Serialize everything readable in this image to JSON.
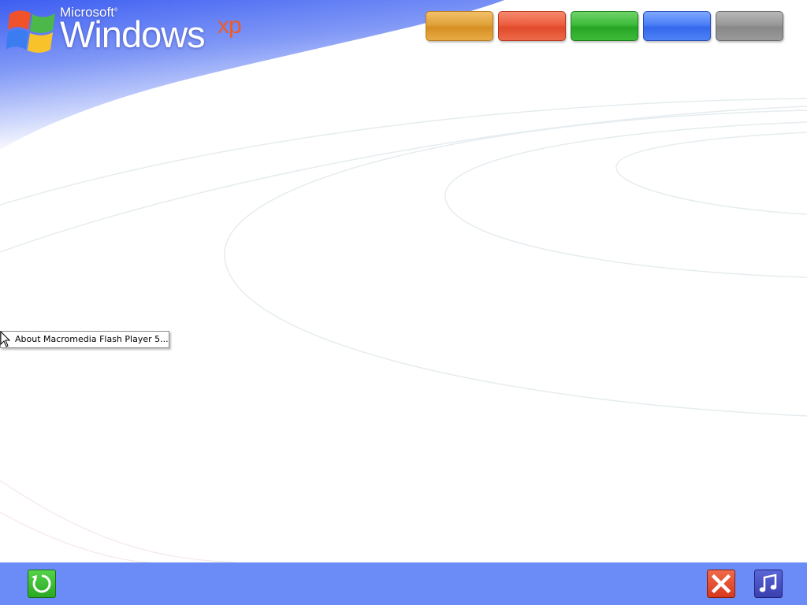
{
  "logo": {
    "microsoft": "Microsoft",
    "windows": "Windows",
    "xp": "xp"
  },
  "top_buttons": [
    {
      "name": "orange-button",
      "color": "#e0a238"
    },
    {
      "name": "red-button",
      "color": "#ec5e3e"
    },
    {
      "name": "green-button",
      "color": "#3ebb3a"
    },
    {
      "name": "blue-button",
      "color": "#4b7ef5"
    },
    {
      "name": "gray-button",
      "color": "#999999"
    }
  ],
  "context_menu": {
    "item": "About Macromedia Flash Player 5..."
  },
  "bottom_bar": {
    "color": "#6b8cf6",
    "left_icon": "replay-icon",
    "right_icons": [
      "close-icon",
      "music-icon"
    ]
  },
  "colors": {
    "sky": "#5a7cf0",
    "xp_accent": "#f05a28"
  }
}
